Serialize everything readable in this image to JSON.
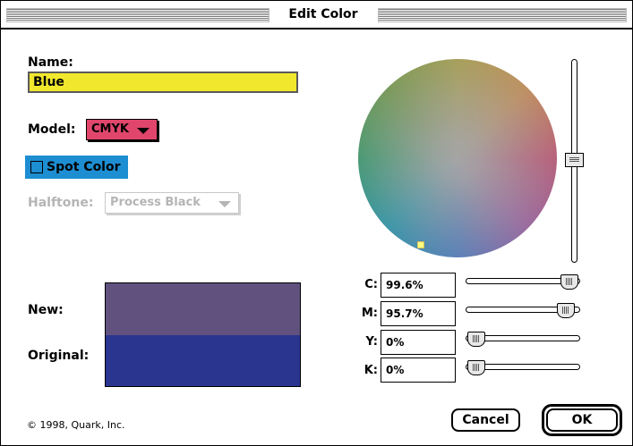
{
  "window": {
    "title": "Edit Color"
  },
  "name": {
    "label": "Name:",
    "value": "Blue"
  },
  "model": {
    "label": "Model:",
    "value": "CMYK",
    "color": "#e0466b"
  },
  "spot_color": {
    "label": "Spot Color",
    "checked": false,
    "highlight": "#1d8ed2"
  },
  "halftone": {
    "label": "Halftone:",
    "value": "Process Black",
    "enabled": false
  },
  "swatches": {
    "new_label": "New:",
    "original_label": "Original:",
    "new_color": "#61517f",
    "original_color": "#2a3590"
  },
  "cmyk": [
    {
      "label": "C:",
      "value": "99.6%",
      "slider_fraction": 0.996
    },
    {
      "label": "M:",
      "value": "95.7%",
      "slider_fraction": 0.957
    },
    {
      "label": "Y:",
      "value": "0%",
      "slider_fraction": 0.0
    },
    {
      "label": "K:",
      "value": "0%",
      "slider_fraction": 0.0
    }
  ],
  "brightness_slider": {
    "icon": "vertical-slider-thumb"
  },
  "footer": {
    "copyright": "© 1998, Quark, Inc."
  },
  "buttons": {
    "cancel": "Cancel",
    "ok": "OK"
  }
}
